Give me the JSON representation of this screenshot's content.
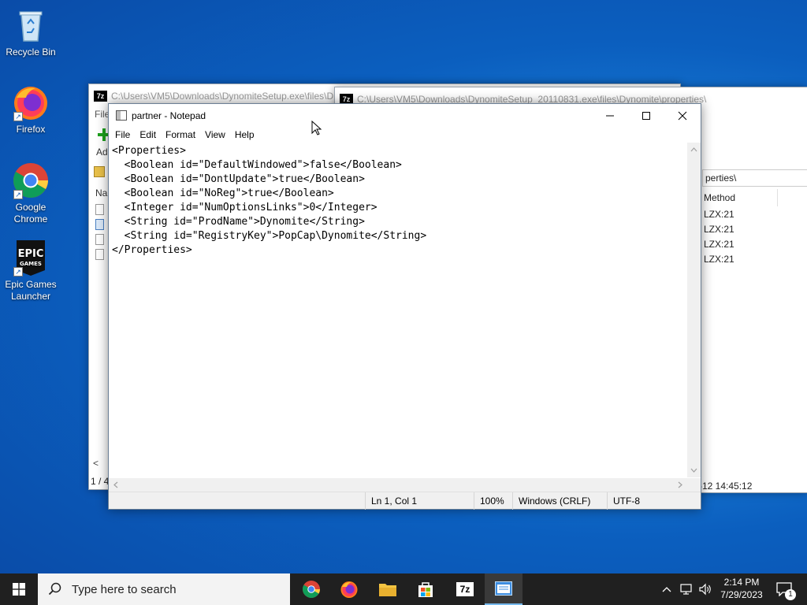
{
  "desktop": {
    "icons": [
      {
        "label": "Recycle Bin"
      },
      {
        "label": "Firefox"
      },
      {
        "label": "Google Chrome"
      },
      {
        "label": "Epic Games Launcher"
      }
    ]
  },
  "sevenzip_back": {
    "title": "C:\\Users\\VM5\\Downloads\\DynomiteSetup.exe\\files\\D",
    "menu_fragment": "File",
    "toolbar_fragment": "Ad",
    "column_fragment": "Na",
    "status_fragment": "1 / 4"
  },
  "sevenzip_front": {
    "title": "C:\\Users\\VM5\\Downloads\\DynomiteSetup_20110831.exe\\files\\Dynomite\\properties\\",
    "path_fragment": "perties\\",
    "column_method": "Method",
    "rows": [
      "LZX:21",
      "LZX:21",
      "LZX:21",
      "LZX:21"
    ],
    "status_fragment": "-12 14:45:12"
  },
  "notepad": {
    "title": "partner - Notepad",
    "menu": [
      "File",
      "Edit",
      "Format",
      "View",
      "Help"
    ],
    "content": "<Properties>\n  <Boolean id=\"DefaultWindowed\">false</Boolean>\n  <Boolean id=\"DontUpdate\">true</Boolean>\n  <Boolean id=\"NoReg\">true</Boolean>\n  <Integer id=\"NumOptionsLinks\">0</Integer>\n  <String id=\"ProdName\">Dynomite</String>\n  <String id=\"RegistryKey\">PopCap\\Dynomite</String>\n</Properties>",
    "status": {
      "position": "Ln 1, Col 1",
      "zoom": "100%",
      "line_ending": "Windows (CRLF)",
      "encoding": "UTF-8"
    }
  },
  "taskbar": {
    "search_placeholder": "Type here to search",
    "time": "2:14 PM",
    "date": "7/29/2023",
    "notification_count": "1",
    "sevenzip_label": "7z"
  },
  "colors": {
    "accent": "#76b9ed",
    "taskbar": "#202020",
    "desktop": "#0b5fbf"
  }
}
